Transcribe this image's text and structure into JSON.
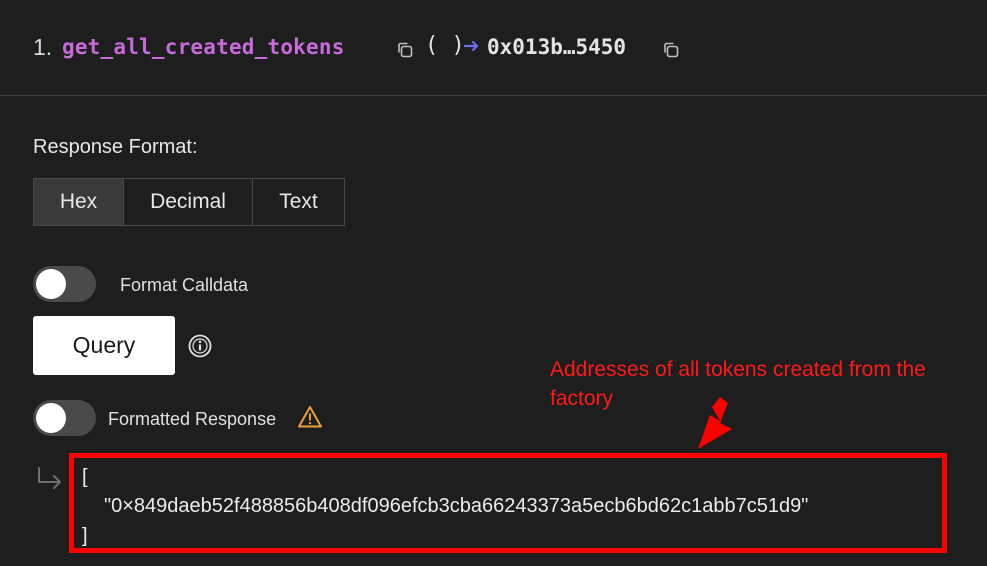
{
  "function": {
    "index": "1.",
    "name": "get_all_created_tokens",
    "params": "( )",
    "return_address": "0x013b…5450"
  },
  "response_format": {
    "label": "Response Format:",
    "options": [
      "Hex",
      "Decimal",
      "Text"
    ],
    "selected": "Hex"
  },
  "format_calldata": {
    "label": "Format Calldata",
    "enabled": false
  },
  "query": {
    "label": "Query"
  },
  "formatted_response": {
    "label": "Formatted Response",
    "enabled": false
  },
  "response": {
    "open_bracket": "[",
    "value": "\"0×849daeb52f488856b408df096efcb3cba66243373a5ecb6bd62c1abb7c51d9\"",
    "close_bracket": "]"
  },
  "annotation": {
    "text": "Addresses of all tokens created from the factory"
  },
  "colors": {
    "background": "#1e1e1e",
    "function_name": "#c66bd9",
    "arrow": "#6e6cf0",
    "annotation": "#ff0000",
    "warning": "#e8a13a"
  },
  "icons": {
    "copy": "copy-icon",
    "arrow": "arrow-right-icon",
    "info": "info-icon",
    "warning": "warning-icon",
    "return": "return-arrow-icon"
  }
}
